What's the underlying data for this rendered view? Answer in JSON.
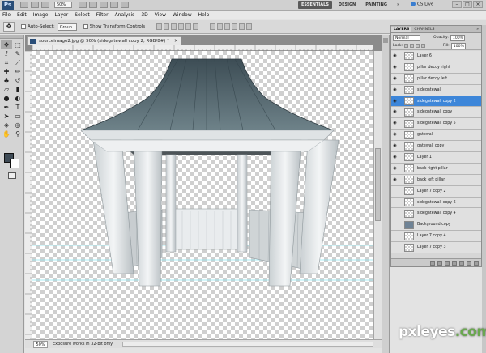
{
  "app": {
    "logo": "Ps",
    "zoom": "50%",
    "workspaces": [
      "ESSENTIALS",
      "DESIGN",
      "PAINTING"
    ],
    "more": "»",
    "cs_live": "CS Live",
    "window_controls": [
      "–",
      "□",
      "×"
    ]
  },
  "menus": [
    "File",
    "Edit",
    "Image",
    "Layer",
    "Select",
    "Filter",
    "Analysis",
    "3D",
    "View",
    "Window",
    "Help"
  ],
  "options": {
    "tool_icon": "move-tool",
    "auto_select_label": "Auto-Select:",
    "auto_select_value": "Group",
    "show_transform_label": "Show Transform Controls"
  },
  "document": {
    "tab_title": "sourceimage2.jpg @ 50% (sidegatewall copy 2, RGB/8#) *",
    "close": "×",
    "status_zoom": "50%",
    "status_message": "Exposure works in 32-bit only"
  },
  "layers_panel": {
    "tabs": [
      "LAYERS",
      "CHANNELS"
    ],
    "more": "»",
    "blend_mode": "Normal",
    "opacity_label": "Opacity:",
    "opacity_value": "100%",
    "lock_label": "Lock:",
    "fill_label": "Fill:",
    "fill_value": "100%",
    "layers": [
      {
        "name": "Layer 6",
        "visible": true,
        "selected": false,
        "thumb": "transparent"
      },
      {
        "name": "pillar decoy right",
        "visible": true,
        "selected": false,
        "thumb": "transparent"
      },
      {
        "name": "pillar decoy left",
        "visible": true,
        "selected": false,
        "thumb": "transparent"
      },
      {
        "name": "sidegatewall",
        "visible": true,
        "selected": false,
        "thumb": "transparent"
      },
      {
        "name": "sidegatewall copy 2",
        "visible": true,
        "selected": true,
        "thumb": "transparent"
      },
      {
        "name": "sidegatewall copy",
        "visible": true,
        "selected": false,
        "thumb": "transparent"
      },
      {
        "name": "sidegatewall copy 5",
        "visible": true,
        "selected": false,
        "thumb": "transparent"
      },
      {
        "name": "gatewall",
        "visible": true,
        "selected": false,
        "thumb": "transparent"
      },
      {
        "name": "gatewall copy",
        "visible": true,
        "selected": false,
        "thumb": "transparent"
      },
      {
        "name": "Layer 1",
        "visible": true,
        "selected": false,
        "thumb": "transparent"
      },
      {
        "name": "back right pillar",
        "visible": true,
        "selected": false,
        "thumb": "transparent"
      },
      {
        "name": "back left pillar",
        "visible": true,
        "selected": false,
        "thumb": "transparent"
      },
      {
        "name": "Layer 7 copy 2",
        "visible": false,
        "selected": false,
        "thumb": "transparent"
      },
      {
        "name": "sidegatewall copy 6",
        "visible": false,
        "selected": false,
        "thumb": "transparent"
      },
      {
        "name": "sidegatewall copy 4",
        "visible": false,
        "selected": false,
        "thumb": "transparent"
      },
      {
        "name": "Background copy",
        "visible": false,
        "selected": false,
        "thumb": "photo"
      },
      {
        "name": "Layer 7 copy 4",
        "visible": false,
        "selected": false,
        "thumb": "transparent"
      },
      {
        "name": "Layer 7 copy 3",
        "visible": false,
        "selected": false,
        "thumb": "transparent"
      }
    ]
  },
  "watermark": {
    "text": "pxleyes",
    "suffix": ".com"
  },
  "colors": {
    "accent": "#3d86d9",
    "foreground_swatch": "#3e4a55",
    "background_swatch": "#ffffff",
    "roof": "#5b6e77",
    "wall": "#e6e9ea"
  }
}
